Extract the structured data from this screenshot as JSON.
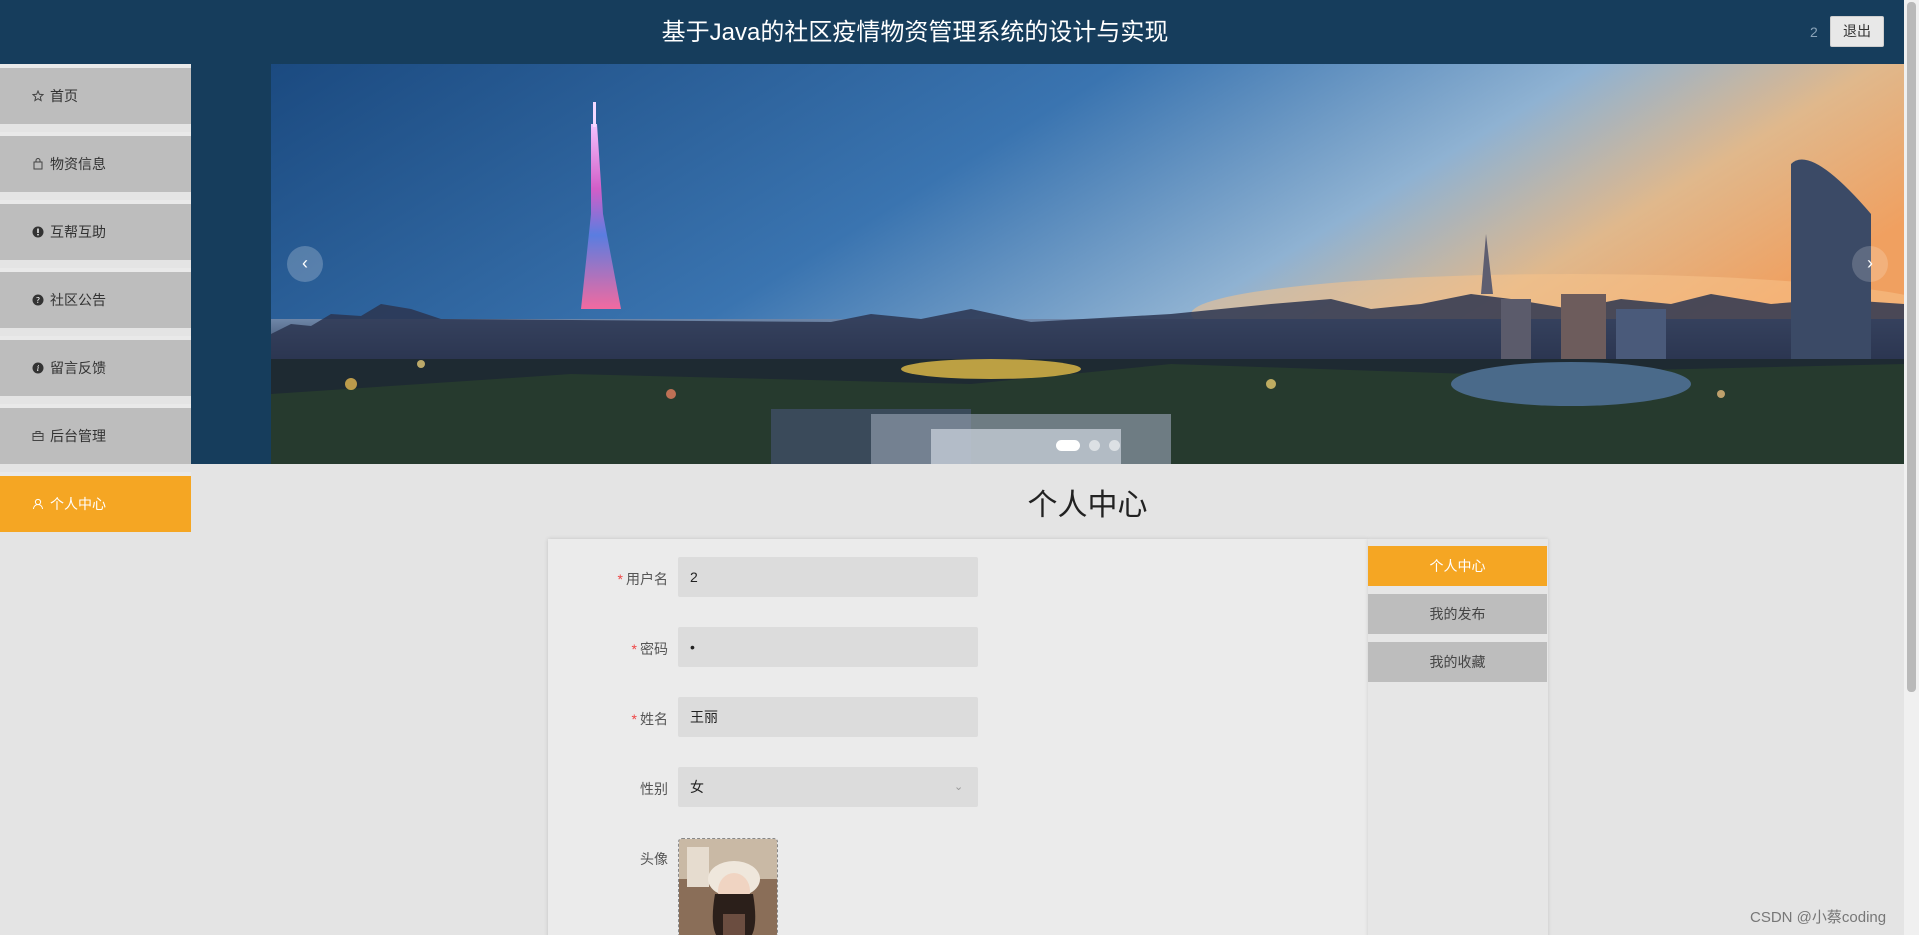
{
  "header": {
    "title": "基于Java的社区疫情物资管理系统的设计与实现",
    "user": "2",
    "logout_label": "退出"
  },
  "sidebar": {
    "items": [
      {
        "label": "首页",
        "icon": "star-icon"
      },
      {
        "label": "物资信息",
        "icon": "bag-icon"
      },
      {
        "label": "互帮互助",
        "icon": "exclamation-circle-icon"
      },
      {
        "label": "社区公告",
        "icon": "question-circle-icon"
      },
      {
        "label": "留言反馈",
        "icon": "info-circle-icon"
      },
      {
        "label": "后台管理",
        "icon": "briefcase-icon"
      },
      {
        "label": "个人中心",
        "icon": "user-icon",
        "active": true
      }
    ]
  },
  "carousel": {
    "prev_icon": "chevron-left-icon",
    "next_icon": "chevron-right-icon",
    "slide_count": 3,
    "active_index": 0
  },
  "main": {
    "title": "个人中心"
  },
  "form": {
    "username": {
      "label": "用户名",
      "value": "2",
      "required": true
    },
    "password": {
      "label": "密码",
      "value": "•",
      "required": true
    },
    "name": {
      "label": "姓名",
      "value": "王丽",
      "required": true
    },
    "gender": {
      "label": "性别",
      "value": "女"
    },
    "avatar": {
      "label": "头像"
    }
  },
  "side_menu": {
    "items": [
      {
        "label": "个人中心",
        "active": true
      },
      {
        "label": "我的发布"
      },
      {
        "label": "我的收藏"
      }
    ]
  },
  "watermark": "CSDN @小蔡coding",
  "colors": {
    "header_bg": "#163d5c",
    "accent": "#f5a623",
    "nav_bg": "#bdbdbd"
  }
}
